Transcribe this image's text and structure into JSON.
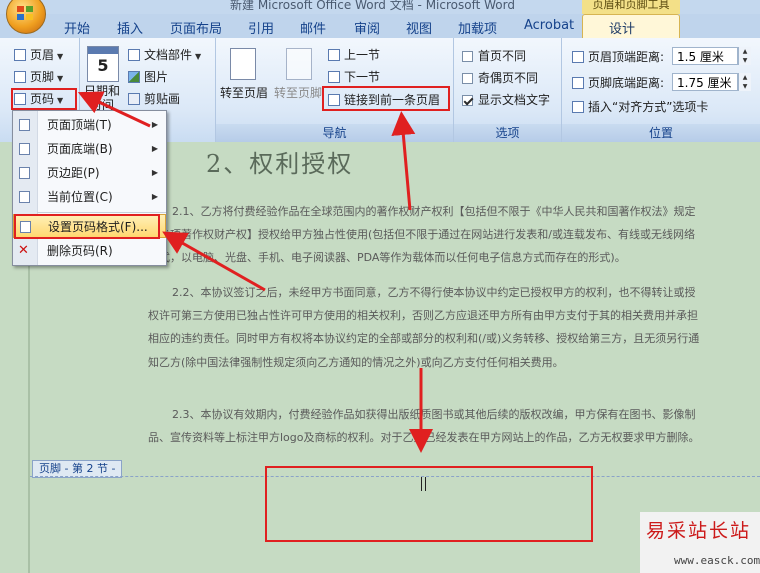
{
  "window": {
    "title": "新建 Microsoft Office Word 文档 - Microsoft Word",
    "context_tab_title": "页眉和页脚工具"
  },
  "tabs": [
    "开始",
    "插入",
    "页面布局",
    "引用",
    "邮件",
    "审阅",
    "视图",
    "加载项",
    "Acrobat",
    "设计"
  ],
  "active_tab": "设计",
  "ribbon": {
    "header_footer": {
      "header": "页眉",
      "footer": "页脚",
      "page_number": "页码"
    },
    "insert": {
      "date_time_1": "日期和",
      "date_time_2": "时间",
      "doc_parts": "文档部件",
      "picture": "图片",
      "clip_art": "剪贴画"
    },
    "navigation": {
      "goto_header": "转至页眉",
      "goto_footer": "转至页脚",
      "prev_section": "上一节",
      "next_section": "下一节",
      "link_previous": "链接到前一条页眉",
      "label": "导航"
    },
    "options": {
      "diff_first": "首页不同",
      "diff_odd_even": "奇偶页不同",
      "show_text": "显示文档文字",
      "label": "选项",
      "diff_first_checked": false,
      "diff_odd_even_checked": false,
      "show_text_checked": true
    },
    "position": {
      "header_top": "页眉顶端距离:",
      "header_top_value": "1.5 厘米",
      "footer_bottom": "页脚底端距离:",
      "footer_bottom_value": "1.75 厘米",
      "align_tab": "插入“对齐方式”选项卡",
      "label": "位置"
    }
  },
  "menu": {
    "items": [
      "页面顶端(T)",
      "页面底端(B)",
      "页边距(P)",
      "当前位置(C)",
      "设置页码格式(F)...",
      "删除页码(R)"
    ],
    "highlighted": "设置页码格式(F)..."
  },
  "document": {
    "heading": "2、权利授权",
    "paragraphs": [
      "2.1、乙方将付费经验作品在全球范围内的著作权财产权利【包括但不限于《中华人民共和国著作权法》规定的各项著作权财产权】授权给甲方独占性使用(包括但不限于通过在网站进行发表和/或连载发布、有线或无线网络方式，以电脑、光盘、手机、电子阅读器、PDA等作为载体而以任何电子信息方式而存在的形式)。",
      "2.2、本协议签订之后，未经甲方书面同意，乙方不得行使本协议中约定已授权甲方的权利，也不得转让或授权许可第三方使用已独占性许可甲方使用的相关权利，否则乙方应退还甲方所有由甲方支付于其的相关费用并承担相应的违约责任。同时甲方有权将本协议约定的全部或部分的权利和(/或)义务转移、授权给第三方，且无须另行通知乙方(除中国法律强制性规定须向乙方通知的情况之外)或向乙方支付任何相关费用。",
      "2.3、本协议有效期内，付费经验作品如获得出版纸质图书或其他后续的版权改编，甲方保有在图书、影像制品、宣传资料等上标注甲方logo及商标的权利。对于乙方已经发表在甲方网站上的作品，乙方无权要求甲方删除。"
    ],
    "footer_tag": "页脚 - 第 2 节 -"
  },
  "watermark": {
    "title": "易采站长站",
    "url": "www.easck.com"
  },
  "colors": {
    "annotation": "#e02020",
    "page": "#c6dbc3",
    "ribbon_text": "#15428b",
    "menu_highlight": "#ffd870"
  }
}
